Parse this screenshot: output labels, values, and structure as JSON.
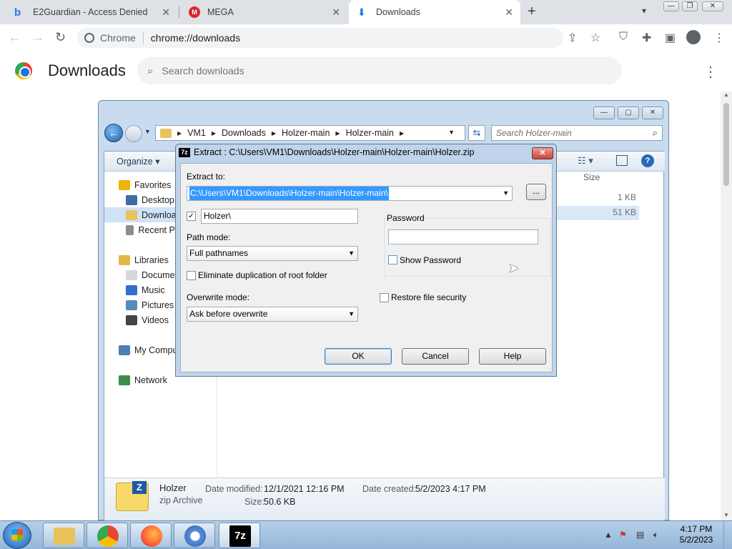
{
  "browser": {
    "tabs": [
      {
        "title": "E2Guardian - Access Denied",
        "icon": "bing-icon",
        "color": "#2a7ae2"
      },
      {
        "title": "MEGA",
        "icon": "mega-icon",
        "color": "#d9272e"
      },
      {
        "title": "Downloads",
        "icon": "download-icon",
        "color": "#1a73e8",
        "active": true
      }
    ],
    "new_tab_label": "+",
    "omnibox": {
      "chip": "Chrome",
      "url": "chrome://downloads"
    }
  },
  "downloads_page": {
    "title": "Downloads",
    "search_placeholder": "Search downloads"
  },
  "explorer": {
    "breadcrumb": [
      "VM1",
      "Downloads",
      "Holzer-main",
      "Holzer-main"
    ],
    "search_placeholder": "Search Holzer-main",
    "organize_label": "Organize",
    "size_header": "Size",
    "file_sizes": [
      "1 KB",
      "51 KB"
    ],
    "nav_tree": [
      {
        "label": "Favorites",
        "icon": "star-icon",
        "color": "#f0b400",
        "indent": 0
      },
      {
        "label": "Desktop",
        "icon": "desktop-icon",
        "color": "#3a6ea5",
        "indent": 1
      },
      {
        "label": "Downloads",
        "icon": "downloads-folder-icon",
        "color": "#e8c25a",
        "indent": 1,
        "selected": true
      },
      {
        "label": "Recent Places",
        "icon": "recent-icon",
        "color": "#8c8c8c",
        "indent": 1
      },
      {
        "label": "Libraries",
        "icon": "library-icon",
        "color": "#e3b74a",
        "indent": 0,
        "gap": true
      },
      {
        "label": "Documents",
        "icon": "documents-icon",
        "color": "#d7d7d7",
        "indent": 1
      },
      {
        "label": "Music",
        "icon": "music-icon",
        "color": "#2f6fcf",
        "indent": 1
      },
      {
        "label": "Pictures",
        "icon": "pictures-icon",
        "color": "#5a8ab8",
        "indent": 1
      },
      {
        "label": "Videos",
        "icon": "videos-icon",
        "color": "#444444",
        "indent": 1
      },
      {
        "label": "My Computer",
        "icon": "computer-icon",
        "color": "#4d7fb0",
        "indent": 0,
        "gap": true
      },
      {
        "label": "Network",
        "icon": "network-icon",
        "color": "#3d8c4a",
        "indent": 0,
        "gap": true
      }
    ],
    "details": {
      "name": "Holzer",
      "type": "zip Archive",
      "modified_label": "Date modified:",
      "modified_value": "12/1/2021 12:16 PM",
      "created_label": "Date created:",
      "created_value": "5/2/2023 4:17 PM",
      "size_label": "Size:",
      "size_value": "50.6 KB"
    }
  },
  "zip_dialog": {
    "title": "Extract : C:\\Users\\VM1\\Downloads\\Holzer-main\\Holzer-main\\Holzer.zip",
    "extract_to_label": "Extract to:",
    "extract_to_value": "C:\\Users\\VM1\\Downloads\\Holzer-main\\Holzer-main\\",
    "browse_label": "...",
    "subfolder_checked": true,
    "subfolder_value": "Holzer\\",
    "path_mode_label": "Path mode:",
    "path_mode_value": "Full pathnames",
    "eliminate_dup_label": "Eliminate duplication of root folder",
    "overwrite_mode_label": "Overwrite mode:",
    "overwrite_mode_value": "Ask before overwrite",
    "password_group_label": "Password",
    "password_value": "",
    "show_password_label": "Show Password",
    "restore_security_label": "Restore file security",
    "ok_label": "OK",
    "cancel_label": "Cancel",
    "help_label": "Help"
  },
  "taskbar": {
    "apps": [
      {
        "name": "explorer",
        "icon": "folder-icon"
      },
      {
        "name": "chrome",
        "icon": "chrome-icon"
      },
      {
        "name": "firefox",
        "icon": "firefox-icon"
      },
      {
        "name": "chromium",
        "icon": "chromium-icon"
      },
      {
        "name": "7zip",
        "icon": "7zip-icon",
        "label": "7z"
      }
    ],
    "clock_time": "4:17 PM",
    "clock_date": "5/2/2023"
  }
}
